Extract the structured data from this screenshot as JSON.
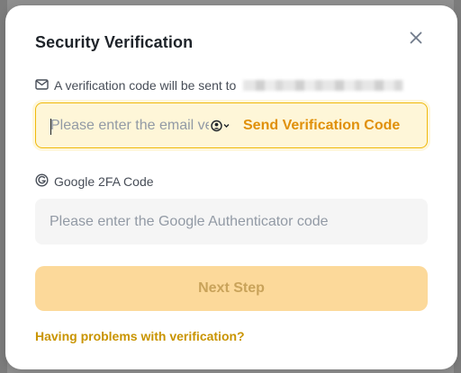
{
  "dialog": {
    "title": "Security Verification"
  },
  "email_section": {
    "label": "A verification code will be sent to",
    "input_placeholder": "Please enter the email verification code",
    "send_button_label": "Send Verification Code"
  },
  "google_section": {
    "label": "Google 2FA Code",
    "input_placeholder": "Please enter the Google Authenticator code"
  },
  "actions": {
    "next_label": "Next Step",
    "help_link": "Having problems with verification?"
  },
  "colors": {
    "accent": "#f0b90b",
    "link": "#c99400",
    "send_code": "#e0900a",
    "next_button_disabled": "#fcd99a"
  },
  "icons": {
    "email_label": "mail-icon",
    "google_label": "google-icon",
    "close": "close-icon",
    "autofill": "contact-autofill-icon"
  }
}
